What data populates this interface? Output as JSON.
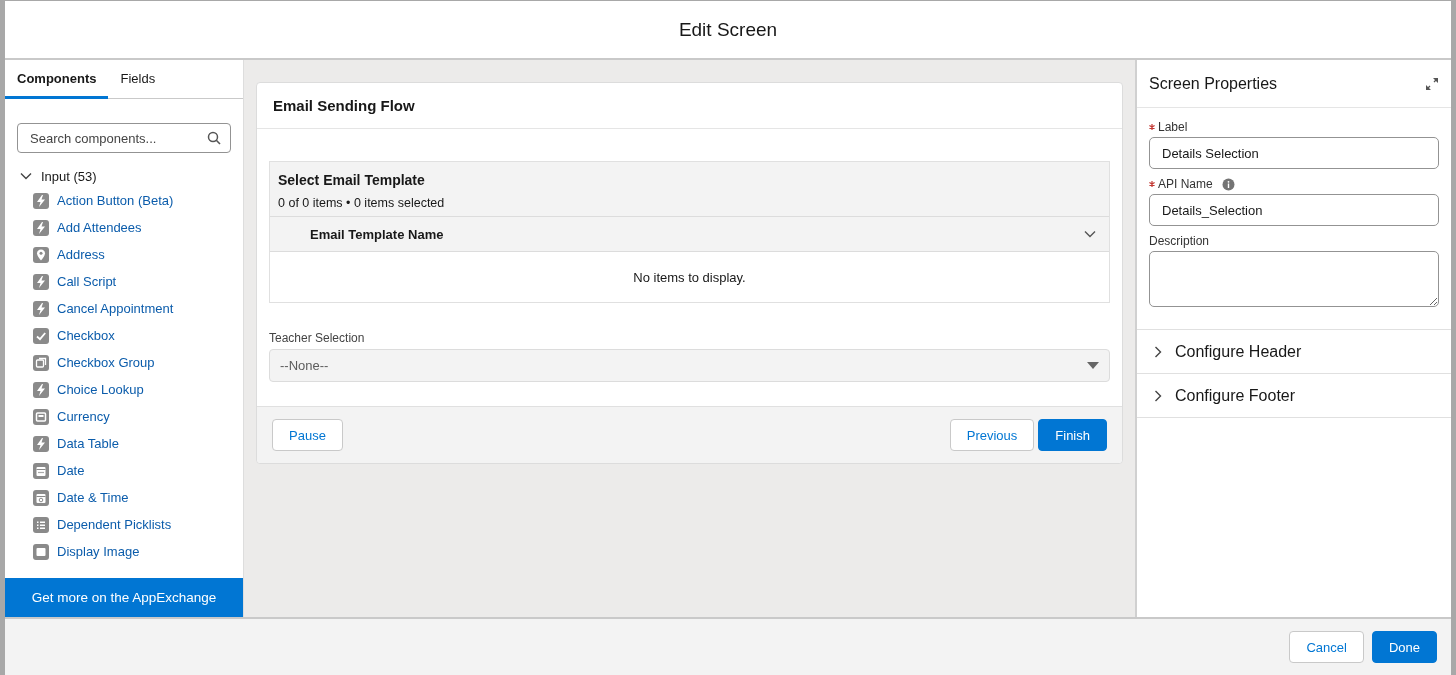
{
  "window": {
    "title": "Edit Screen"
  },
  "tabs": [
    {
      "label": "Components",
      "selected": true
    },
    {
      "label": "Fields",
      "selected": false
    }
  ],
  "search": {
    "placeholder": "Search components..."
  },
  "group": {
    "label": "Input (53)",
    "expanded": true,
    "items": [
      {
        "label": "Action Button (Beta)",
        "kind": "bolt"
      },
      {
        "label": "Add Attendees",
        "kind": "bolt"
      },
      {
        "label": "Address",
        "kind": "pin"
      },
      {
        "label": "Call Script",
        "kind": "bolt"
      },
      {
        "label": "Cancel Appointment",
        "kind": "bolt"
      },
      {
        "label": "Checkbox",
        "kind": "check"
      },
      {
        "label": "Checkbox Group",
        "kind": "checkgroup"
      },
      {
        "label": "Choice Lookup",
        "kind": "bolt"
      },
      {
        "label": "Currency",
        "kind": "currency"
      },
      {
        "label": "Data Table",
        "kind": "bolt"
      },
      {
        "label": "Date",
        "kind": "calendar"
      },
      {
        "label": "Date & Time",
        "kind": "datetime"
      },
      {
        "label": "Dependent Picklists",
        "kind": "list"
      },
      {
        "label": "Display Image",
        "kind": "image"
      }
    ]
  },
  "appexchange": "Get more on the AppExchange",
  "canvas": {
    "title": "Email Sending Flow",
    "table": {
      "title": "Select Email Template",
      "count": "0 of 0 items • 0 items selected",
      "column": "Email Template Name",
      "empty": "No items to display."
    },
    "picklist": {
      "label": "Teacher Selection",
      "value": "--None--"
    },
    "buttons": [
      {
        "label": "Pause",
        "kind": "neutral"
      },
      {
        "label": "Previous",
        "kind": "neutral"
      },
      {
        "label": "Finish",
        "kind": "brand"
      }
    ]
  },
  "properties": {
    "title": "Screen Properties",
    "fields": [
      {
        "label": "Label",
        "required": true,
        "info": false,
        "value": "Details Selection",
        "kind": "input"
      },
      {
        "label": "API Name",
        "required": true,
        "info": true,
        "value": "Details_Selection",
        "kind": "input"
      },
      {
        "label": "Description",
        "required": false,
        "info": false,
        "kind": "textarea"
      }
    ],
    "sections": [
      {
        "label": "Configure Header",
        "expanded": false
      },
      {
        "label": "Configure Footer",
        "expanded": false
      }
    ]
  },
  "footer_buttons": [
    {
      "label": "Cancel",
      "kind": "neutral"
    },
    {
      "label": "Done",
      "kind": "brand"
    }
  ]
}
